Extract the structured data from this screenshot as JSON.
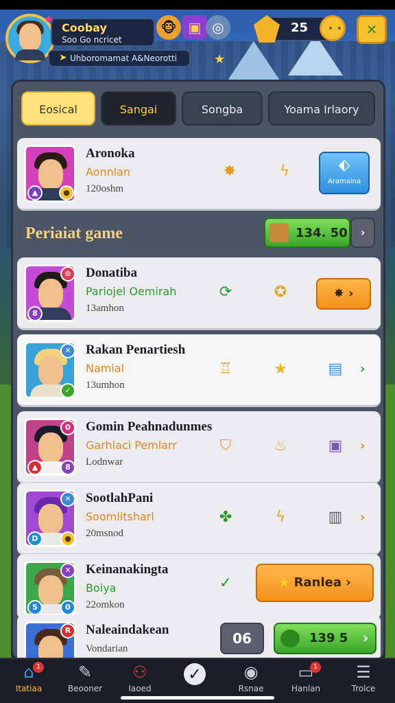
{
  "header": {
    "player_name": "Coobay",
    "player_sub": "Soo Go ncricet",
    "subbar_text": "Uhboromamat A&Neorotti",
    "currency_value": "25"
  },
  "tabs": [
    {
      "label": "Eosical"
    },
    {
      "label": "Sangai"
    },
    {
      "label": "Songba"
    },
    {
      "label": "Yoama Irlaory"
    }
  ],
  "featured": {
    "title": "Aronoka",
    "subtitle": "Aonnlan",
    "meta": "120oshm",
    "button_label": "Aramaina"
  },
  "section": {
    "title": "Periaiat game",
    "value": "134. 50"
  },
  "items": [
    {
      "title": "Donatiba",
      "subtitle": "Pariojel Oemirah",
      "meta": "13amhon"
    },
    {
      "title": "Rakan Penartiesh",
      "subtitle": "Namial",
      "meta": "13umhon"
    },
    {
      "title": "Gomin Peahnadunmes",
      "subtitle": "Garhlaci Pemlarr",
      "meta": "Lodnwar"
    },
    {
      "title": "SootlahPani",
      "subtitle": "Soomlitsharl",
      "meta": "20msnod"
    },
    {
      "title": "Keinanakingta",
      "subtitle": "Boiya",
      "meta": "22omkon",
      "button_label": "Ranlea"
    },
    {
      "title": "Naleaindakean",
      "subtitle": "",
      "meta": "Vondarian",
      "count": "06",
      "value": "139 5"
    }
  ],
  "nav": [
    {
      "label": "Itatiaa",
      "icon": "home-icon",
      "badge": "1"
    },
    {
      "label": "Beooner",
      "icon": "wrench-icon"
    },
    {
      "label": "Iaoed",
      "icon": "group-icon"
    },
    {
      "label": "",
      "icon": "check-icon"
    },
    {
      "label": "Rsnae",
      "icon": "camera-icon"
    },
    {
      "label": "Hanlan",
      "icon": "chat-icon",
      "badge": "1"
    },
    {
      "label": "Trolce",
      "icon": "menu-icon"
    }
  ],
  "colors": {
    "accent": "#f5c12e",
    "panel": "#4c5566",
    "green": "#3aa52a",
    "orange": "#f3901a"
  }
}
